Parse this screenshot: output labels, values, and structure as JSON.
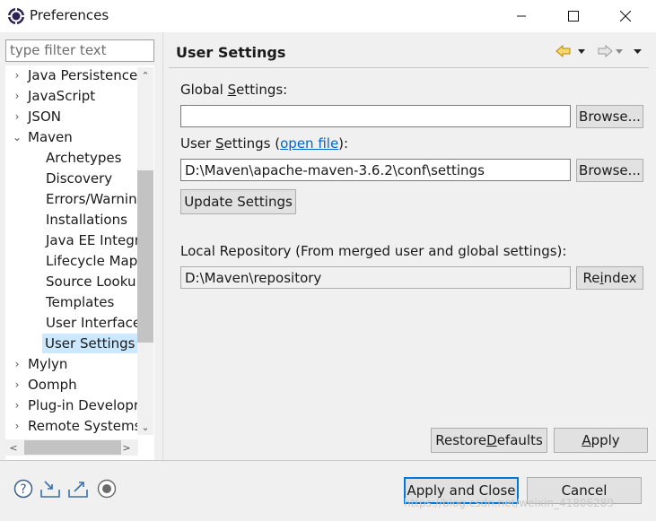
{
  "window": {
    "title": "Preferences",
    "app_icon": "eclipse-gear-icon"
  },
  "filter": {
    "placeholder": "type filter text"
  },
  "tree": {
    "items": [
      {
        "label": "Java Persistence",
        "arrow": "›",
        "level": 0
      },
      {
        "label": "JavaScript",
        "arrow": "›",
        "level": 0
      },
      {
        "label": "JSON",
        "arrow": "›",
        "level": 0
      },
      {
        "label": "Maven",
        "arrow": "⌄",
        "level": 0
      },
      {
        "label": "Archetypes",
        "arrow": "",
        "level": 1
      },
      {
        "label": "Discovery",
        "arrow": "",
        "level": 1
      },
      {
        "label": "Errors/Warnin",
        "arrow": "",
        "level": 1
      },
      {
        "label": "Installations",
        "arrow": "",
        "level": 1
      },
      {
        "label": "Java EE Integra",
        "arrow": "",
        "level": 1
      },
      {
        "label": "Lifecycle Map",
        "arrow": "",
        "level": 1
      },
      {
        "label": "Source Looku",
        "arrow": "",
        "level": 1
      },
      {
        "label": "Templates",
        "arrow": "",
        "level": 1
      },
      {
        "label": "User Interface",
        "arrow": "",
        "level": 1
      },
      {
        "label": "User Settings",
        "arrow": "",
        "level": 1,
        "selected": true
      },
      {
        "label": "Mylyn",
        "arrow": "›",
        "level": 0
      },
      {
        "label": "Oomph",
        "arrow": "›",
        "level": 0
      },
      {
        "label": "Plug-in Developr",
        "arrow": "›",
        "level": 0
      },
      {
        "label": "Remote Systems",
        "arrow": "›",
        "level": 0
      }
    ]
  },
  "page": {
    "title": "User Settings",
    "global_settings": {
      "label_pre": "Global ",
      "label_mnemonic": "S",
      "label_post": "ettings:",
      "value": "",
      "browse": "Browse..."
    },
    "user_settings": {
      "label_pre": "User ",
      "label_mnemonic": "S",
      "label_mid": "ettings (",
      "link": "open file",
      "label_post": "):",
      "value": "D:\\Maven\\apache-maven-3.6.2\\conf\\settings",
      "browse": "Browse..."
    },
    "update_button": "Update Settings",
    "local_repo": {
      "label": "Local Repository (From merged user and global settings):",
      "value": "D:\\Maven\\repository",
      "reindex_pre": "Re",
      "reindex_mnemonic": "i",
      "reindex_post": "ndex"
    },
    "restore_defaults": {
      "pre": "Restore ",
      "mnemonic": "D",
      "post": "efaults"
    },
    "apply": {
      "mnemonic": "A",
      "post": "pply"
    }
  },
  "footer": {
    "apply_and_close": "Apply and Close",
    "cancel": "Cancel",
    "icons": [
      "help-icon",
      "import-icon",
      "export-icon",
      "record-icon"
    ]
  },
  "watermark": "https://blog.csdn.net/weixin_41806289",
  "colors": {
    "accent": "#0078d7",
    "selection": "#cce8ff",
    "link": "#0066cc",
    "nav_arrow": "#d4a017"
  }
}
